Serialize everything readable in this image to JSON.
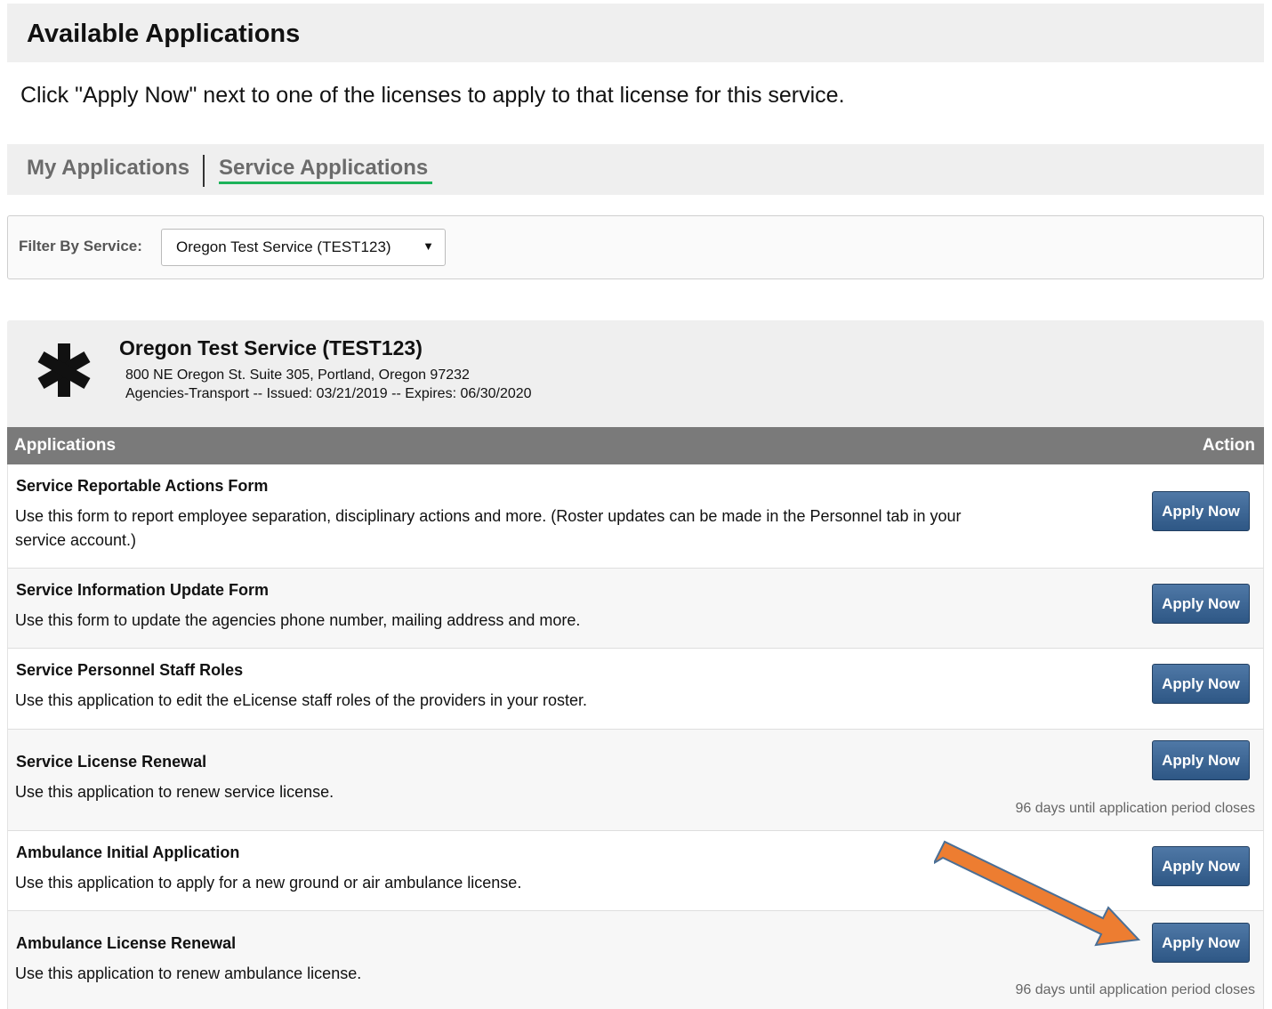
{
  "page": {
    "title": "Available Applications",
    "instruction": "Click \"Apply Now\" next to one of the licenses to apply to that license for this service."
  },
  "tabs": {
    "my_applications": "My Applications",
    "service_applications": "Service Applications",
    "active": "Service Applications"
  },
  "filter": {
    "label": "Filter By Service:",
    "selected": "Oregon Test Service (TEST123)"
  },
  "service": {
    "name": "Oregon Test Service (TEST123)",
    "address": "800 NE Oregon St. Suite 305, Portland, Oregon 97232",
    "meta": "Agencies-Transport -- Issued: 03/21/2019 -- Expires: 06/30/2020",
    "icon": "asterisk-star-of-life-icon"
  },
  "table": {
    "col_applications": "Applications",
    "col_action": "Action"
  },
  "applications": [
    {
      "title": "Service Reportable Actions Form",
      "description": "Use this form to report employee separation, disciplinary actions and more. (Roster updates can be made in the Personnel tab in your service account.)",
      "button": "Apply Now",
      "note": ""
    },
    {
      "title": "Service Information Update Form",
      "description": "Use this form to update the agencies phone number, mailing address and more.",
      "button": "Apply Now",
      "note": ""
    },
    {
      "title": "Service Personnel Staff Roles",
      "description": "Use this application to edit the eLicense staff roles of the providers in your roster.",
      "button": "Apply Now",
      "note": ""
    },
    {
      "title": "Service License Renewal",
      "description": "Use this application to renew service license.",
      "button": "Apply Now",
      "note": "96 days until application period closes"
    },
    {
      "title": "Ambulance Initial Application",
      "description": "Use this application to apply for a new ground or air ambulance license.",
      "button": "Apply Now",
      "note": ""
    },
    {
      "title": "Ambulance License Renewal",
      "description": "Use this application to renew ambulance license.",
      "button": "Apply Now",
      "note": "96 days until application period closes"
    }
  ],
  "colors": {
    "accent_underline": "#1db35a",
    "button": "#3b6491",
    "table_header": "#7a7a7a",
    "annotation_arrow": "#ed7d31"
  },
  "annotation": {
    "icon": "orange-arrow-icon",
    "points_to": "Ambulance License Renewal Apply Now button"
  }
}
